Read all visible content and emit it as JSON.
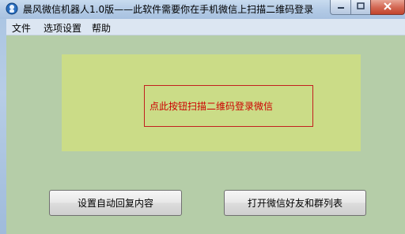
{
  "window": {
    "title": "晨风微信机器人1.0版——此软件需要你在手机微信上扫描二维码登录"
  },
  "menu": {
    "items": [
      {
        "label": "文件"
      },
      {
        "label": "选项设置"
      },
      {
        "label": "帮助"
      }
    ]
  },
  "main": {
    "qr_login_label": "点此按钮扫描二维码登录微信",
    "auto_reply_button": "设置自动回复内容",
    "friends_button": "打开微信好友和群列表"
  },
  "colors": {
    "panel_bg": "#cbdc87",
    "client_bg": "#b5cda8",
    "qr_text": "#cc0000"
  }
}
